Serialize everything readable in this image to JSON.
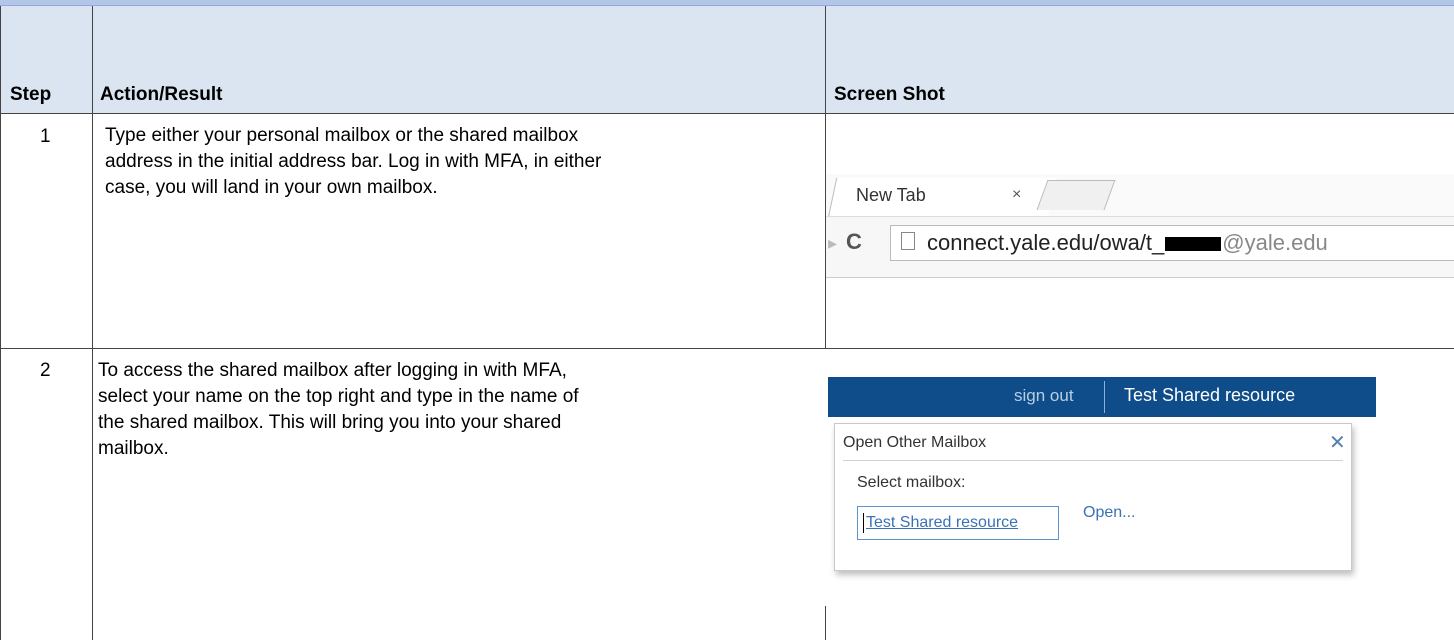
{
  "table": {
    "headers": {
      "step": "Step",
      "action": "Action/Result",
      "screenshot": "Screen Shot"
    },
    "rows": [
      {
        "step": "1",
        "lines": [
          "Type either your personal mailbox or the shared mailbox",
          "address in the initial address bar.  Log in with MFA, in either",
          "case, you will land in your own mailbox."
        ]
      },
      {
        "step": "2",
        "lines": [
          "To access the shared mailbox after logging in with MFA,",
          "select your name on the top right and type in the name of",
          "the shared mailbox.  This will bring you into your shared",
          "mailbox."
        ]
      }
    ]
  },
  "browser_shot": {
    "tab_title": "New Tab",
    "tab_close": "×",
    "reload_icon": "C",
    "url_host": "connect.yale.edu/owa/t_",
    "url_domain": "@yale.edu"
  },
  "owa_shot": {
    "sign_out": "sign out",
    "user_name": "Test Shared resource",
    "dialog_title": "Open Other Mailbox",
    "dialog_close": "✕",
    "select_label": "Select mailbox:",
    "input_value": "Test Shared resource",
    "open_button": "Open..."
  },
  "colors": {
    "header_bg": "#dbe5f1",
    "top_band": "#b4c6e7",
    "owa_bar": "#0f4c8a",
    "link_blue": "#3a72b5"
  }
}
